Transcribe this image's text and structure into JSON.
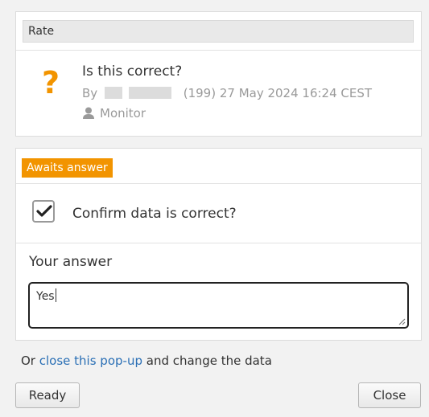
{
  "rate_panel": {
    "header": "Rate",
    "question_icon": "question-mark-icon",
    "question": "Is this correct?",
    "by_label": "By",
    "meta": "(199) 27 May 2024 16:24 CEST",
    "role_icon": "person-icon",
    "role": "Monitor"
  },
  "answer_panel": {
    "status": "Awaits answer",
    "checkbox_checked": true,
    "confirm_label": "Confirm data is correct?",
    "your_answer_label": "Your answer",
    "answer_value": "Yes"
  },
  "footer": {
    "prefix": "Or",
    "link": "close this pop-up",
    "suffix": "and change the data"
  },
  "buttons": {
    "ready": "Ready",
    "close": "Close"
  },
  "colors": {
    "accent": "#f29400",
    "link": "#2a6fb5",
    "background": "#f2f2f2"
  }
}
